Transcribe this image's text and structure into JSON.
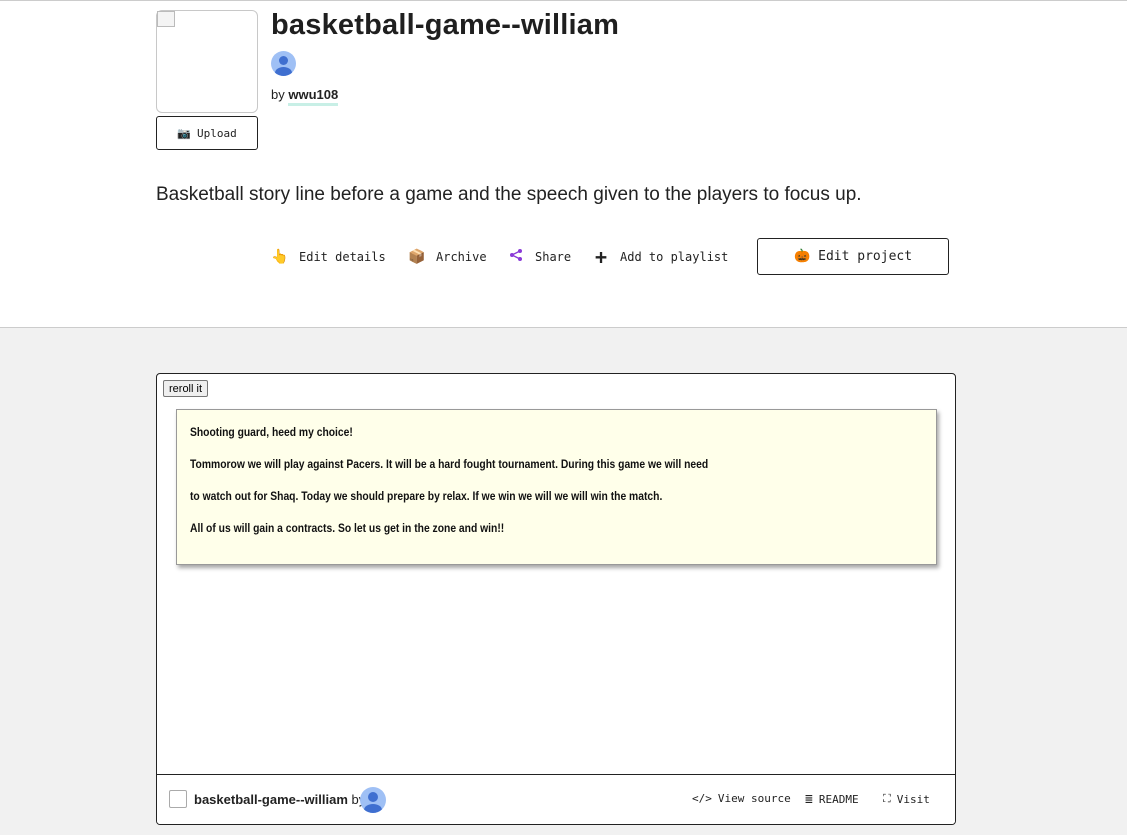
{
  "header": {
    "title": "basketball-game--william",
    "by_label": "by",
    "username": "wwu108",
    "upload_label": "Upload",
    "description": "Basketball story line before a game and the speech given to the players to focus up."
  },
  "actions": [
    {
      "label": "Edit details",
      "icon": "pointing-hand-icon"
    },
    {
      "label": "Archive",
      "icon": "box-icon"
    },
    {
      "label": "Share",
      "icon": "share-icon"
    },
    {
      "label": "Add to playlist",
      "icon": "plus-icon"
    }
  ],
  "edit_project_label": "Edit project",
  "app": {
    "reroll_label": "reroll it",
    "lines": [
      "Shooting guard, heed my choice!",
      "Tommorow we will play against Pacers. It will be a hard fought tournament. During this game we will need",
      "to watch out for Shaq. Today we should prepare by relax. If we win we will we will win the match.",
      "All of us will gain a contracts. So let us get in the zone and win!!"
    ]
  },
  "footer": {
    "project_name": "basketball-game--william",
    "by_label": "by",
    "view_source_label": "View source",
    "readme_label": "README",
    "visit_label": "Visit"
  },
  "colors": {
    "note_bg": "#ffffea",
    "page_bg": "#f1f1f1",
    "avatar_bg": "#9fc0f5",
    "avatar_fg": "#3f6fd0",
    "username_underline": "#c8efe6"
  }
}
